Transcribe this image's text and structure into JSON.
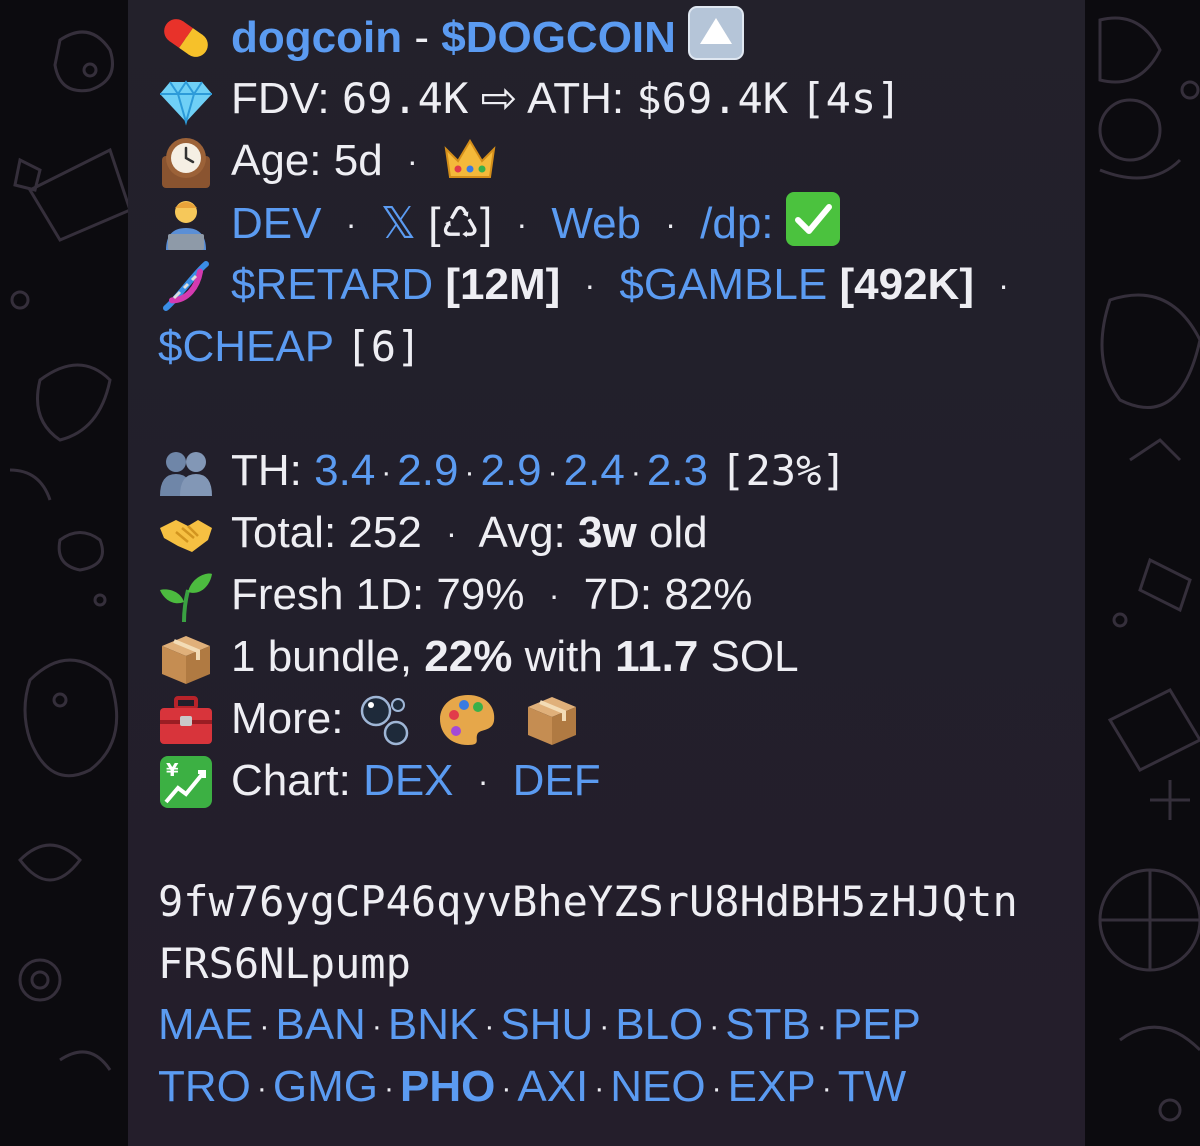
{
  "token": {
    "name": "dogcoin",
    "dash": "-",
    "ticker": "$DOGCOIN"
  },
  "fdv": {
    "label": "FDV:",
    "value": "69.4K",
    "arrow": "⇨",
    "ath_label": "ATH:",
    "ath_value": "$69.4K",
    "ath_time": "[4s]"
  },
  "age": {
    "label": "Age:",
    "value": "5d",
    "dot": "·"
  },
  "dev_line": {
    "dev": "DEV",
    "x": "𝕏",
    "recycle": "[♺]",
    "web": "Web",
    "dp": "/dp:"
  },
  "related": {
    "t1": "$RETARD",
    "t1_val": "[12M]",
    "t2": "$GAMBLE",
    "t2_val": "[492K]",
    "t3": "$CHEAP",
    "t3_val": "[6]",
    "dot": "·"
  },
  "holders": {
    "label": "TH:",
    "values": [
      "3.4",
      "2.9",
      "2.9",
      "2.4",
      "2.3"
    ],
    "pct": "[23%]"
  },
  "total": {
    "label": "Total:",
    "value": "252",
    "avg_label": "Avg:",
    "avg_value": "3w",
    "avg_suffix": "old"
  },
  "fresh": {
    "label": "Fresh 1D:",
    "d1": "79%",
    "d7_label": "7D:",
    "d7": "82%"
  },
  "bundle": {
    "prefix": "1 bundle,",
    "pct": "22%",
    "mid": "with",
    "amount": "11.7",
    "suffix": "SOL"
  },
  "more": {
    "label": "More:"
  },
  "chart": {
    "label": "Chart:",
    "dex": "DEX",
    "def": "DEF"
  },
  "address": {
    "line1": "9fw76ygCP46qyvBheYZSrU8HdBH5zHJQtn",
    "line2": "FRS6NLpump"
  },
  "links_row1": [
    "MAE",
    "BAN",
    "BNK",
    "SHU",
    "BLO",
    "STB",
    "PEP"
  ],
  "links_row2": [
    "TRO",
    "GMG",
    "PHO",
    "AXI",
    "NEO",
    "EXP",
    "TW"
  ],
  "colors": {
    "link": "#5b9bf1",
    "text": "#eeeef3",
    "bubble": "#23212b",
    "background": "#0c0b0f"
  },
  "icons": [
    "pill-icon",
    "diamond-icon",
    "clock-icon",
    "crown-icon",
    "technologist-icon",
    "dna-icon",
    "people-icon",
    "handshake-icon",
    "seedling-icon",
    "package-icon",
    "toolbox-icon",
    "bubbles-icon",
    "palette-icon",
    "chart-yen-icon",
    "check-icon",
    "up-arrow-icon"
  ]
}
